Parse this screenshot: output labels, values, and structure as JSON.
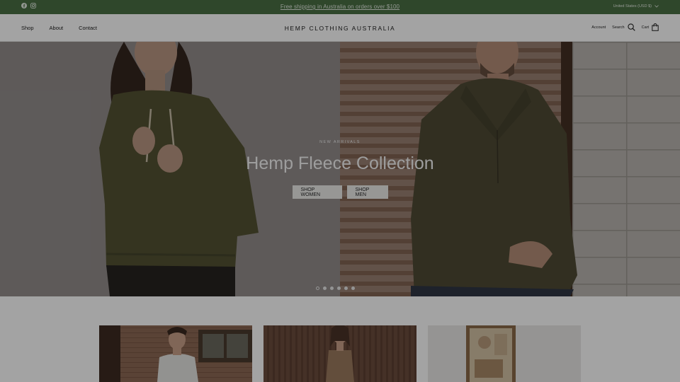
{
  "announcement": {
    "text": "Free shipping in Australia on orders over $100",
    "social": [
      "facebook-icon",
      "instagram-icon"
    ],
    "currency": "United States (USD $)"
  },
  "header": {
    "brand": "HEMP CLOTHING AUSTRALIA",
    "nav": [
      "Shop",
      "About",
      "Contact"
    ],
    "account_label": "Account",
    "search_label": "Search",
    "cart_label": "Cart"
  },
  "hero": {
    "eyebrow": "NEW ARRIVALS",
    "title": "Hemp Fleece Collection",
    "buttons": [
      "SHOP WOMEN",
      "SHOP MEN"
    ],
    "slide_count": 6,
    "active_slide": 1
  },
  "colors": {
    "announcement_bg": "#4a7044",
    "overlay": "rgba(0,0,0,0.36)",
    "fleece_olive": "#5a5a36"
  }
}
